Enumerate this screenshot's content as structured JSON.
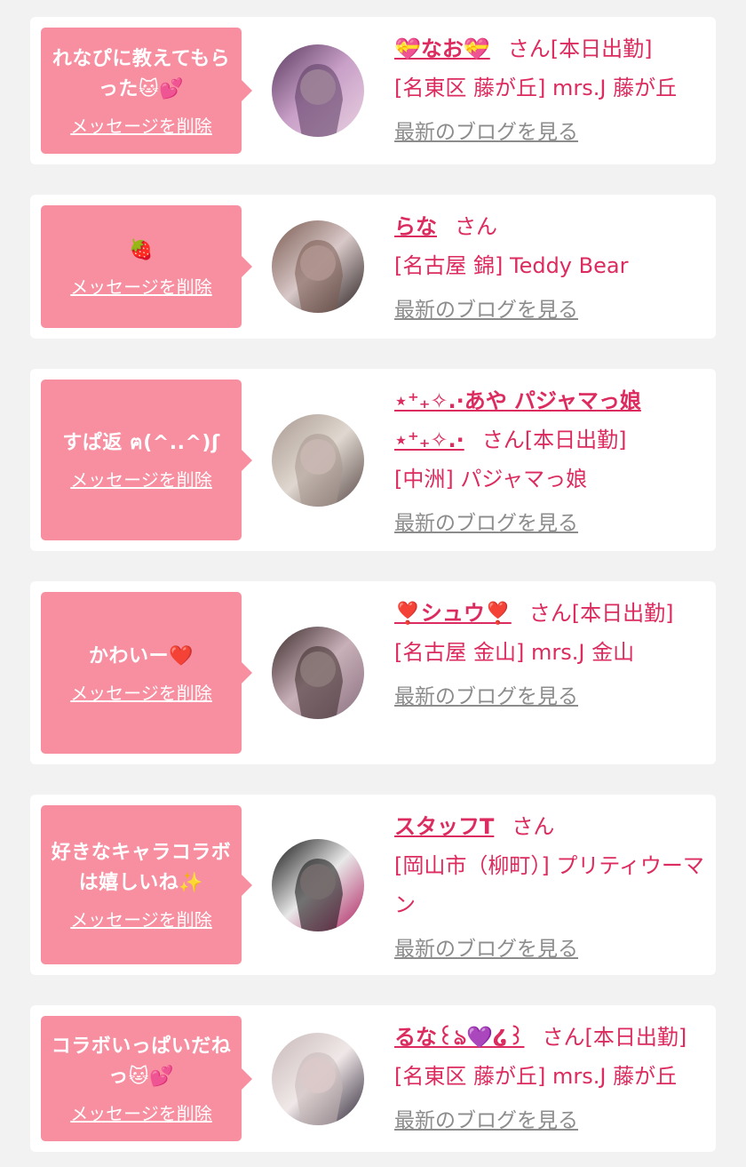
{
  "delete_label": "メッセージを削除",
  "blog_label": "最新のブログを見る",
  "san_label": "さん",
  "cards": [
    {
      "message": "れなぴに教えてもらった🐱💕",
      "name": "💝なお💝",
      "status": "[本日出勤]",
      "shop": "[名東区 藤が丘] mrs.J 藤が丘",
      "avatar_colors": [
        "#5a3a60",
        "#c9a0c8",
        "#e8d0e0"
      ]
    },
    {
      "message": "🍓",
      "name": "らな",
      "status": "",
      "shop": "[名古屋 錦] Teddy Bear",
      "avatar_colors": [
        "#7a5a50",
        "#d8c8c8",
        "#2a2020"
      ]
    },
    {
      "message": "すぱ返 ฅ(^..^)ʃ",
      "name": "⋆⁺₊✧.·あや パジャマっ娘⋆⁺₊✧.·",
      "status": "[本日出勤]",
      "shop": "[中洲] パジャマっ娘",
      "avatar_colors": [
        "#a89890",
        "#e0d8d0",
        "#5a4a48"
      ]
    },
    {
      "message": "かわいー❤️",
      "name": "❣️シュウ❣️",
      "status": "[本日出勤]",
      "shop": "[名古屋 金山] mrs.J 金山",
      "avatar_colors": [
        "#3a2a2a",
        "#c8b0b8",
        "#8a7080"
      ]
    },
    {
      "message": "好きなキャラコラボは嬉しいね✨",
      "name": "スタッフT",
      "status": "",
      "shop": "[岡山市（柳町）] プリティウーマン",
      "avatar_colors": [
        "#101010",
        "#e8e8e8",
        "#b02060"
      ]
    },
    {
      "message": "コラボいっぱいだねっ🐱💕",
      "name": "るな꒰ঌ💜໒꒱",
      "status": "[本日出勤]",
      "shop": "[名東区 藤が丘] mrs.J 藤が丘",
      "avatar_colors": [
        "#c8b8b8",
        "#f0e8e8",
        "#302838"
      ]
    }
  ]
}
